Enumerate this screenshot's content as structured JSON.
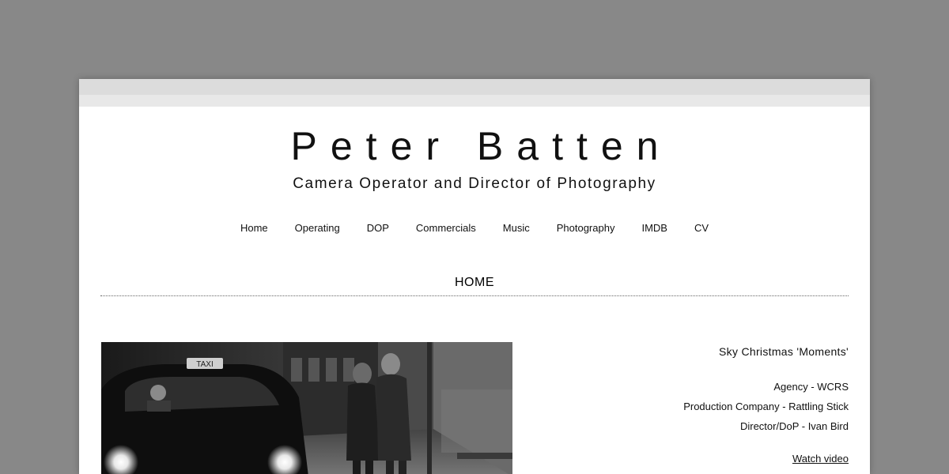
{
  "site": {
    "title": "Peter Batten",
    "subtitle": "Camera Operator and Director of Photography"
  },
  "nav": {
    "items": [
      {
        "label": "Home"
      },
      {
        "label": "Operating"
      },
      {
        "label": "DOP"
      },
      {
        "label": "Commercials"
      },
      {
        "label": "Music"
      },
      {
        "label": "Photography"
      },
      {
        "label": "IMDB"
      },
      {
        "label": "CV"
      }
    ]
  },
  "page": {
    "section_title": "HOME"
  },
  "feature": {
    "taxi_sign": "TAXI",
    "title": "Sky Christmas 'Moments'",
    "credits": [
      "Agency - WCRS",
      "Production Company - Rattling Stick",
      "Director/DoP - Ivan Bird"
    ],
    "watch_label": "Watch video"
  },
  "colors": {
    "backdrop": "#888888",
    "page": "#ffffff",
    "chrome": "#dcdcdc",
    "text": "#111111"
  }
}
